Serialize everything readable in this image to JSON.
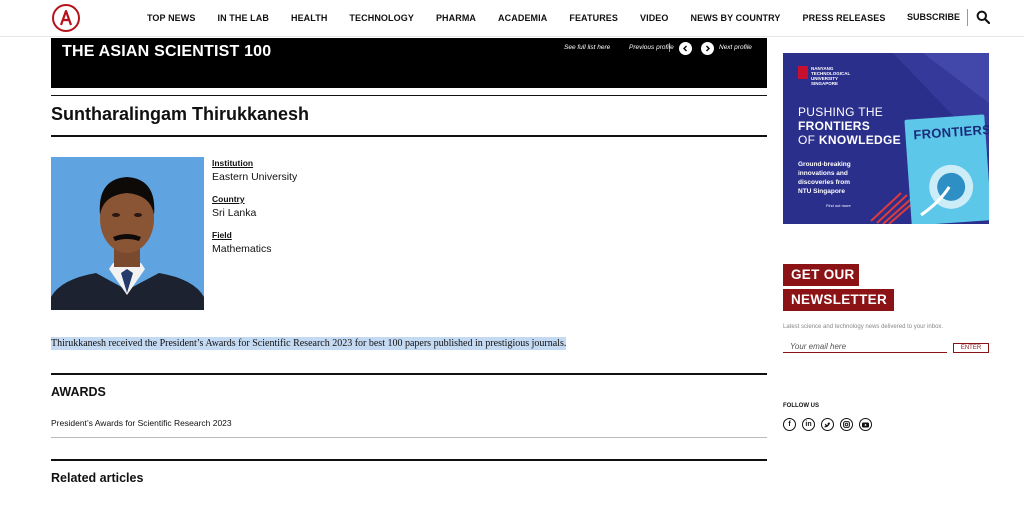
{
  "header": {
    "nav": [
      "TOP NEWS",
      "IN THE LAB",
      "HEALTH",
      "TECHNOLOGY",
      "PHARMA",
      "ACADEMIA",
      "FEATURES",
      "VIDEO",
      "NEWS BY COUNTRY",
      "PRESS RELEASES"
    ],
    "subscribe": "SUBSCRIBE"
  },
  "banner": {
    "title": "THE ASIAN SCIENTIST 100",
    "full_list": "See full list here",
    "previous": "Previous profile",
    "next": "Next profile"
  },
  "profile": {
    "name": "Suntharalingam Thirukkanesh",
    "institution_label": "Institution",
    "institution": "Eastern University",
    "country_label": "Country",
    "country": "Sri Lanka",
    "field_label": "Field",
    "field": "Mathematics",
    "bio": "Thirukkanesh received the President’s Awards for Scientific Research 2023 for best 100 papers published in prestigious journals."
  },
  "awards": {
    "heading": "AWARDS",
    "items": [
      "President’s Awards for Scientific Research 2023"
    ]
  },
  "related": {
    "heading": "Related articles"
  },
  "ad": {
    "university": [
      "NANYANG",
      "TECHNOLOGICAL",
      "UNIVERSITY",
      "SINGAPORE"
    ],
    "headline_1": "PUSHING THE",
    "headline_2": "FRONTIERS",
    "headline_3a": "OF ",
    "headline_3b": "KNOWLEDGE",
    "sub": [
      "Ground-breaking",
      "innovations and",
      "discoveries from",
      "NTU Singapore"
    ],
    "find": "Find out more",
    "magazine": "FRONTIERS"
  },
  "newsletter": {
    "line1": "GET OUR",
    "line2": "NEWSLETTER",
    "desc": "Latest science and technology news delivered to your inbox.",
    "placeholder": "Your email here",
    "button": "ENTER"
  },
  "follow": {
    "label": "FOLLOW US",
    "icons": [
      "facebook-icon",
      "linkedin-icon",
      "twitter-icon",
      "instagram-icon",
      "youtube-icon"
    ]
  },
  "colors": {
    "brand_red": "#8b1315",
    "logo_red": "#b5121b",
    "ad_blue": "#2b2f8c"
  }
}
